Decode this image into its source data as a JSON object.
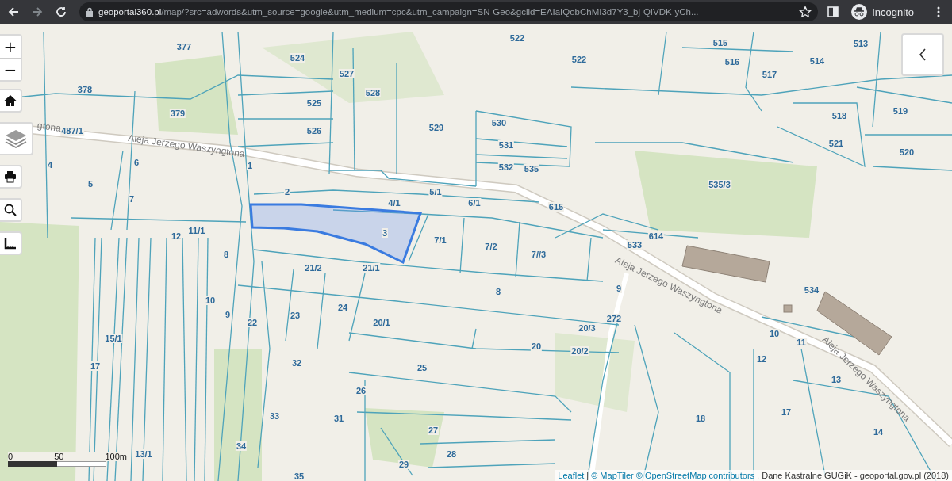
{
  "browser": {
    "url_domain": "geoportal360.pl",
    "url_path": "/map/?src=adwords&utm_source=google&utm_medium=cpc&utm_campaign=SN-Geo&gclid=EAIaIQobChMI3d7Y3_bj-QIVDK-yCh...",
    "profile_label": "Incognito"
  },
  "map_controls": {
    "zoom_in": "+",
    "zoom_out": "−"
  },
  "parcels": [
    {
      "label": "377"
    },
    {
      "label": "524"
    },
    {
      "label": "522"
    },
    {
      "label": "522"
    },
    {
      "label": "515"
    },
    {
      "label": "513"
    },
    {
      "label": "516"
    },
    {
      "label": "514"
    },
    {
      "label": "517"
    },
    {
      "label": "378"
    },
    {
      "label": "527"
    },
    {
      "label": "528"
    },
    {
      "label": "525"
    },
    {
      "label": "519"
    },
    {
      "label": "379"
    },
    {
      "label": "518"
    },
    {
      "label": "530"
    },
    {
      "label": "526"
    },
    {
      "label": "529"
    },
    {
      "label": "487/1"
    },
    {
      "label": "531"
    },
    {
      "label": "521"
    },
    {
      "label": "520"
    },
    {
      "label": "4"
    },
    {
      "label": "6"
    },
    {
      "label": "1"
    },
    {
      "label": "532"
    },
    {
      "label": "535"
    },
    {
      "label": "5"
    },
    {
      "label": "535/3"
    },
    {
      "label": "2"
    },
    {
      "label": "5/1"
    },
    {
      "label": "4/1"
    },
    {
      "label": "6/1"
    },
    {
      "label": "7"
    },
    {
      "label": "615"
    },
    {
      "label": "11/1"
    },
    {
      "label": "3"
    },
    {
      "label": "614"
    },
    {
      "label": "7/1"
    },
    {
      "label": "7/2"
    },
    {
      "label": "7//3"
    },
    {
      "label": "533"
    },
    {
      "label": "12"
    },
    {
      "label": "8"
    },
    {
      "label": "21/2"
    },
    {
      "label": "21/1"
    },
    {
      "label": "8"
    },
    {
      "label": "9"
    },
    {
      "label": "534"
    },
    {
      "label": "10"
    },
    {
      "label": "9"
    },
    {
      "label": "24"
    },
    {
      "label": "23"
    },
    {
      "label": "22"
    },
    {
      "label": "272"
    },
    {
      "label": "20/1"
    },
    {
      "label": "20/3"
    },
    {
      "label": "15/1"
    },
    {
      "label": "10"
    },
    {
      "label": "11"
    },
    {
      "label": "20"
    },
    {
      "label": "20/2"
    },
    {
      "label": "12"
    },
    {
      "label": "17"
    },
    {
      "label": "32"
    },
    {
      "label": "25"
    },
    {
      "label": "13"
    },
    {
      "label": "26"
    },
    {
      "label": "33"
    },
    {
      "label": "31"
    },
    {
      "label": "17"
    },
    {
      "label": "18"
    },
    {
      "label": "27"
    },
    {
      "label": "14"
    },
    {
      "label": "34"
    },
    {
      "label": "28"
    },
    {
      "label": "13/1"
    },
    {
      "label": "29"
    },
    {
      "label": "35"
    }
  ],
  "streets": [
    {
      "label": "gtona"
    },
    {
      "label": "Aleja Jerzego Waszyngtona"
    },
    {
      "label": "Aleja Jerzego Waszyngtona"
    },
    {
      "label": "Aleja Jerzego Waszyngtona"
    }
  ],
  "scale": {
    "labels": [
      "0",
      "50",
      "100m"
    ]
  },
  "attribution": {
    "leaflet": "Leaflet",
    "separator": "|",
    "maptiler": "© MapTiler",
    "osm": "© OpenStreetMap contributors",
    "rest": ", Dane Kastralne GUGiK - geoportal.gov.pl (2018)"
  }
}
